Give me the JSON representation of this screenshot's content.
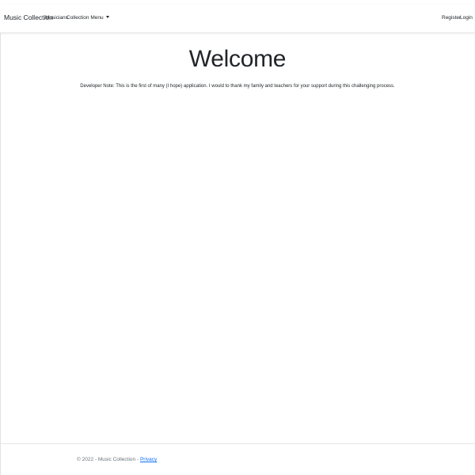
{
  "navbar": {
    "brand": "Music Collection",
    "links": {
      "musicians": "Musicians",
      "collection_menu": "Collection Menu",
      "register": "Register",
      "login": "Login"
    }
  },
  "main": {
    "title": "Welcome",
    "developer_note": "Developer Note: This is the first of many (I hope) application. I would to thank my family and teachers for your support during this challenging process."
  },
  "footer": {
    "text": "© 2022 - Music Collection -",
    "privacy_link": "Privacy"
  },
  "colors": {
    "link": "#0d6efd",
    "muted": "#6c757d",
    "text": "#212529"
  }
}
